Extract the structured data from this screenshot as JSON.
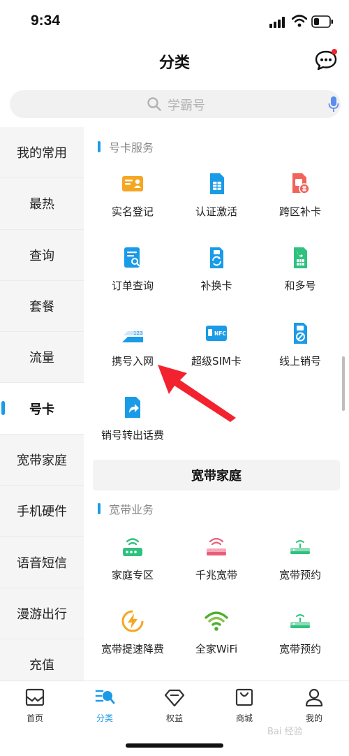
{
  "status_bar": {
    "time": "9:34"
  },
  "header": {
    "title": "分类"
  },
  "search": {
    "placeholder": "学霸号"
  },
  "sidebar": {
    "items": [
      "我的常用",
      "最热",
      "查询",
      "套餐",
      "流量",
      "号卡",
      "宽带家庭",
      "手机硬件",
      "语音短信",
      "漫游出行",
      "充值"
    ],
    "active_index": 5
  },
  "sections": {
    "haoka": {
      "title": "号卡服务",
      "items": [
        "实名登记",
        "认证激活",
        "跨区补卡",
        "订单查询",
        "补换卡",
        "和多号",
        "携号入网",
        "超级SIM卡",
        "线上销号",
        "销号转出话费"
      ]
    },
    "category_heading": "宽带家庭",
    "kuandai": {
      "title": "宽带业务",
      "items": [
        "家庭专区",
        "千兆宽带",
        "宽带预约",
        "宽带提速降费",
        "全家WiFi",
        "宽带预约"
      ]
    }
  },
  "icon_texts": {
    "nfc": "NFC",
    "code": "123"
  },
  "tabbar": {
    "items": [
      "首页",
      "分类",
      "权益",
      "商城",
      "我的"
    ],
    "active_index": 1
  },
  "watermark": "Bai 经验",
  "colors": {
    "accent": "#1a9be8",
    "orange": "#f5a623",
    "red_arrow": "#f2232f",
    "green": "#2ec27e",
    "pink": "#e85d7a"
  }
}
